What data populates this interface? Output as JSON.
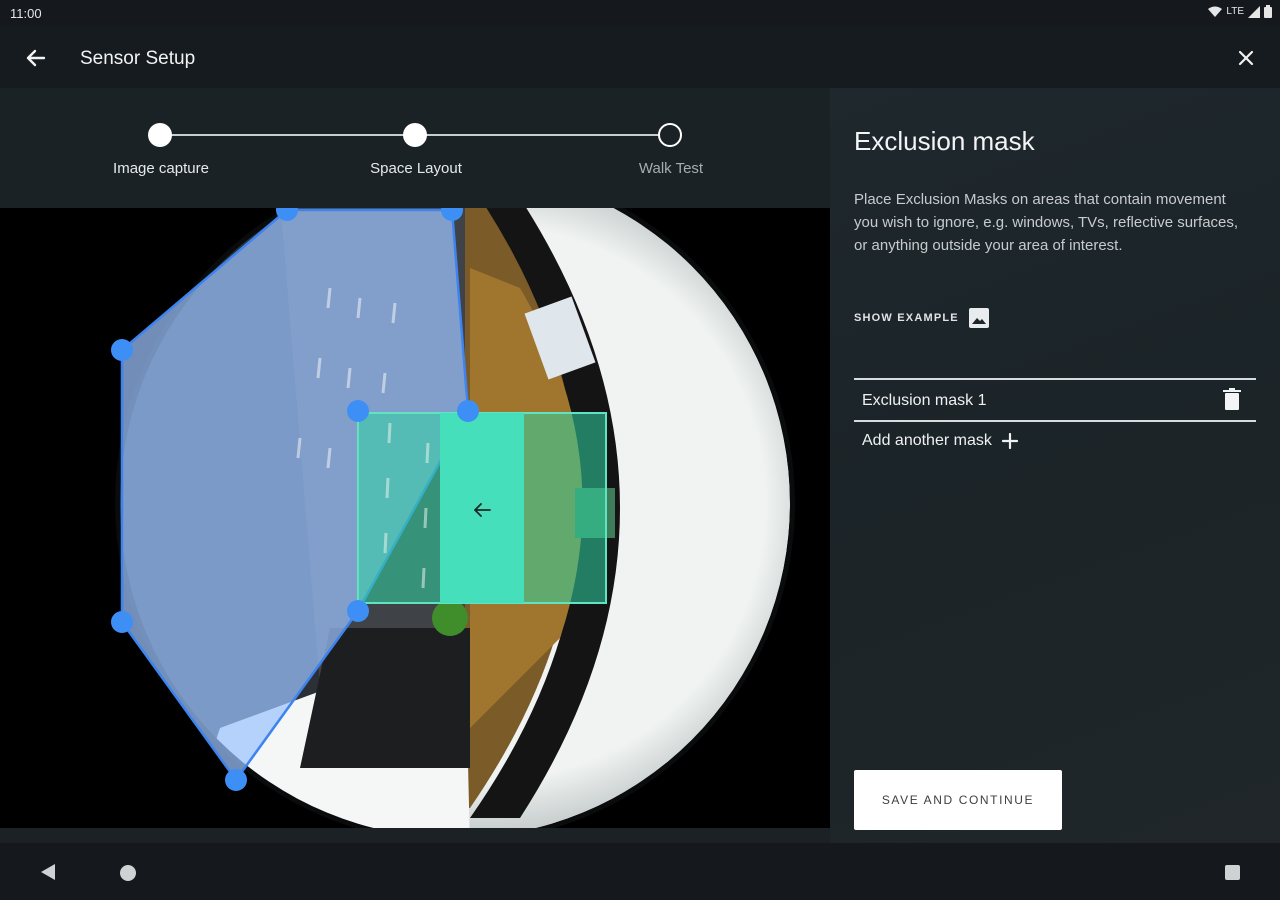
{
  "status_bar": {
    "time": "11:00",
    "network": "LTE",
    "icons": [
      "wifi-icon",
      "signal-icon",
      "battery-icon"
    ]
  },
  "app_bar": {
    "title": "Sensor Setup",
    "back_icon": "arrow-left-icon",
    "close_icon": "close-icon"
  },
  "stepper": {
    "steps": [
      {
        "label": "Image capture",
        "state": "complete"
      },
      {
        "label": "Space Layout",
        "state": "current"
      },
      {
        "label": "Walk Test",
        "state": "upcoming"
      }
    ]
  },
  "editor": {
    "mask_colors": {
      "polygon_fill": "#9cc4ff",
      "polygon_outline": "#3d84f0",
      "handle": "#3d8ff5",
      "rect_fill": "#45e0bb",
      "rect_outline": "#5fe3c3"
    },
    "rect_center_icon": "arrow-left-icon"
  },
  "panel": {
    "title": "Exclusion mask",
    "description": "Place Exclusion Masks on areas that contain movement you wish to ignore, e.g. windows, TVs, reflective surfaces, or anything outside your area of interest.",
    "show_example_label": "SHOW EXAMPLE",
    "show_example_icon": "image-icon",
    "masks": [
      {
        "name": "Exclusion mask 1",
        "action_icon": "trash-icon"
      }
    ],
    "add_mask_label": "Add another mask",
    "add_mask_icon": "plus-icon",
    "save_label": "SAVE AND CONTINUE"
  },
  "nav_bar": {
    "icons": [
      "nav-back-icon",
      "nav-home-icon",
      "nav-recents-icon"
    ]
  }
}
